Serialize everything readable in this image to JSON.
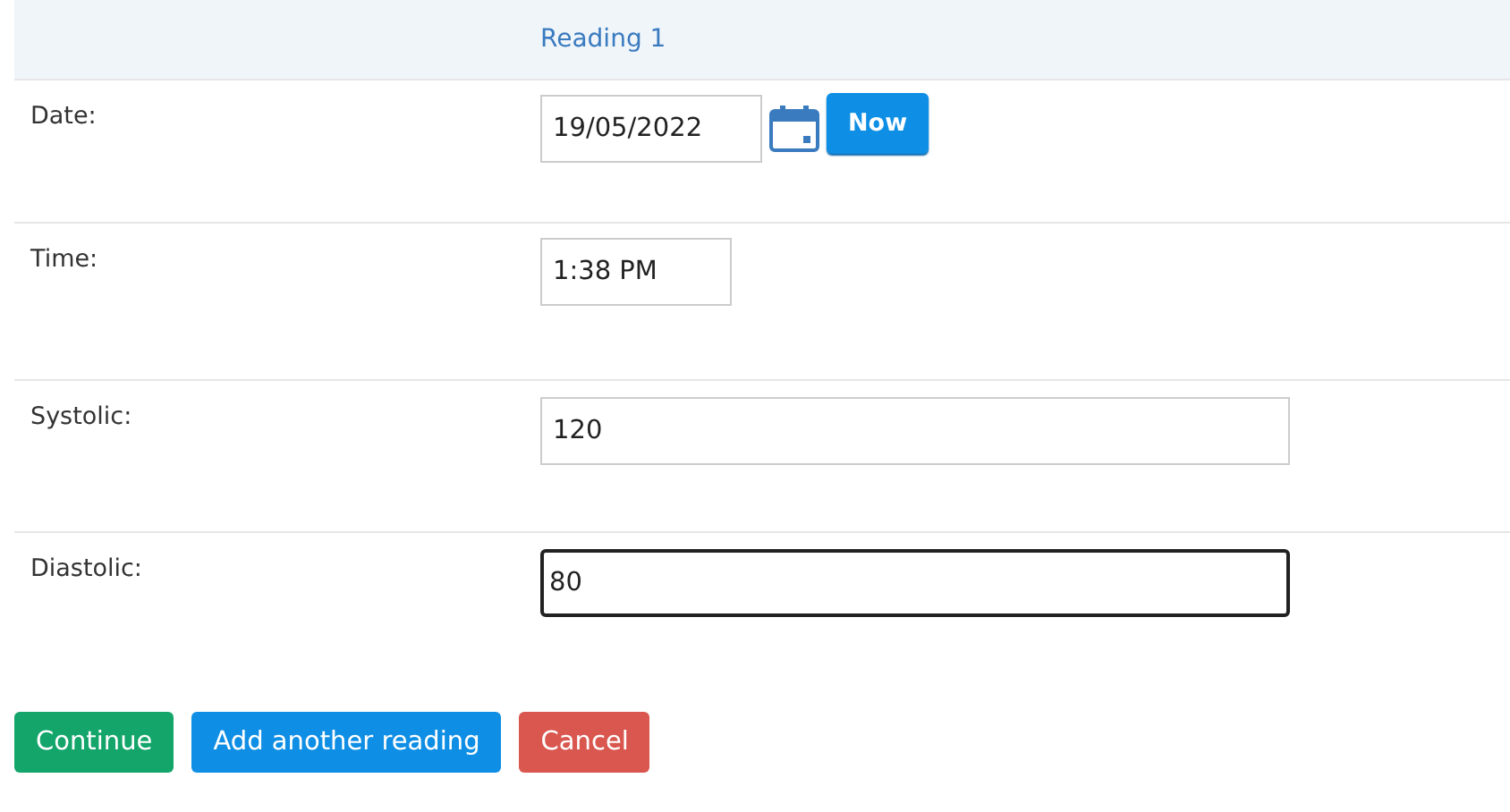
{
  "table": {
    "column_header": "Reading 1",
    "rows": [
      {
        "label": "Date:",
        "kind": "date",
        "value": "19/05/2022",
        "focused": false,
        "button": "Now"
      },
      {
        "label": "Time:",
        "kind": "time",
        "value": "1:38 PM",
        "focused": false
      },
      {
        "label": "Systolic:",
        "kind": "number",
        "value": "120",
        "focused": false
      },
      {
        "label": "Diastolic:",
        "kind": "number",
        "value": "80",
        "focused": true
      }
    ]
  },
  "buttons": [
    {
      "label": "Continue",
      "kind": "success"
    },
    {
      "label": "Add another reading",
      "kind": "primary"
    },
    {
      "label": "Cancel",
      "kind": "danger"
    }
  ]
}
